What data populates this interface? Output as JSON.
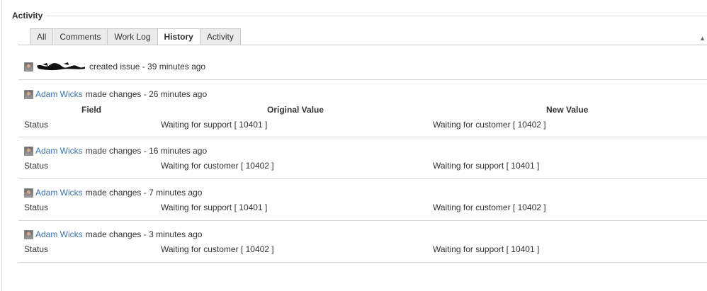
{
  "section": {
    "title": "Activity"
  },
  "tabs": [
    {
      "label": "All",
      "active": false
    },
    {
      "label": "Comments",
      "active": false
    },
    {
      "label": "Work Log",
      "active": false
    },
    {
      "label": "History",
      "active": true
    },
    {
      "label": "Activity",
      "active": false
    }
  ],
  "created": {
    "text": "created issue - 39 minutes ago"
  },
  "table_header": {
    "field": "Field",
    "original": "Original Value",
    "new": "New Value"
  },
  "changes": [
    {
      "author": "Adam Wicks",
      "summary": "made changes - 26 minutes ago",
      "field": "Status",
      "original": "Waiting for support [ 10401 ]",
      "new": "Waiting for customer [ 10402 ]"
    },
    {
      "author": "Adam Wicks",
      "summary": "made changes - 16 minutes ago",
      "field": "Status",
      "original": "Waiting for customer [ 10402 ]",
      "new": "Waiting for support [ 10401 ]"
    },
    {
      "author": "Adam Wicks",
      "summary": "made changes - 7 minutes ago",
      "field": "Status",
      "original": "Waiting for support [ 10401 ]",
      "new": "Waiting for customer [ 10402 ]"
    },
    {
      "author": "Adam Wicks",
      "summary": "made changes - 3 minutes ago",
      "field": "Status",
      "original": "Waiting for customer [ 10402 ]",
      "new": "Waiting for support [ 10401 ]"
    }
  ],
  "colors": {
    "link": "#3b73af",
    "text": "#333333",
    "tab_bg": "#ebebeb",
    "divider": "#d6d6d6"
  },
  "icons": {
    "avatar": "user-avatar-icon",
    "collapse": "collapse-arrow-icon"
  }
}
